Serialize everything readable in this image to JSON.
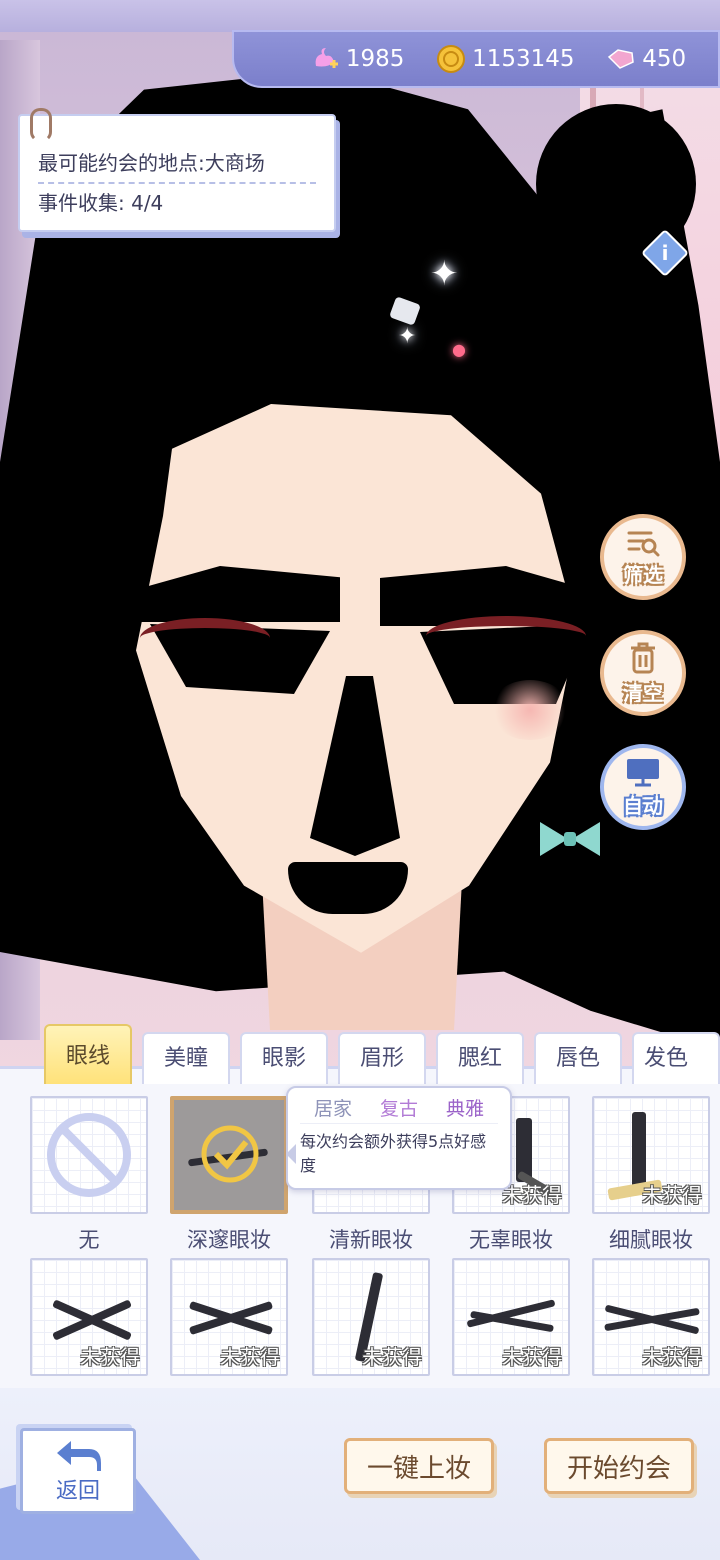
{
  "currencies": [
    {
      "icon": "swan-plus-icon",
      "value": "1985"
    },
    {
      "icon": "gold-coin-icon",
      "value": "1153145"
    },
    {
      "icon": "pink-gem-icon",
      "value": "450"
    }
  ],
  "info_card": {
    "location": "最可能约会的地点:大商场",
    "events": "事件收集: 4/4"
  },
  "side_buttons": {
    "filter": "筛选",
    "clear": "清空",
    "auto": "自动"
  },
  "tabs": [
    "眼线",
    "美瞳",
    "眼影",
    "眉形",
    "腮红",
    "唇色",
    "发色"
  ],
  "active_tab": "眼线",
  "items_row1": [
    {
      "name": "无",
      "status": ""
    },
    {
      "name": "深邃眼妆",
      "status": ""
    },
    {
      "name": "清新眼妆",
      "status": ""
    },
    {
      "name": "无辜眼妆",
      "status": "未获得"
    },
    {
      "name": "细腻眼妆",
      "status": "未获得"
    }
  ],
  "items_row2": [
    {
      "status": "未获得"
    },
    {
      "status": "未获得"
    },
    {
      "status": "未获得"
    },
    {
      "status": "未获得"
    },
    {
      "status": "未获得"
    }
  ],
  "tooltip": {
    "tags": [
      "居家",
      "复古",
      "典雅"
    ],
    "tag_colors": [
      "#8e93b8",
      "#b27bd6",
      "#9b63c9"
    ],
    "description": "每次约会额外获得5点好感度"
  },
  "buttons": {
    "back": "返回",
    "one_click": "一键上妆",
    "start_date": "开始约会"
  }
}
